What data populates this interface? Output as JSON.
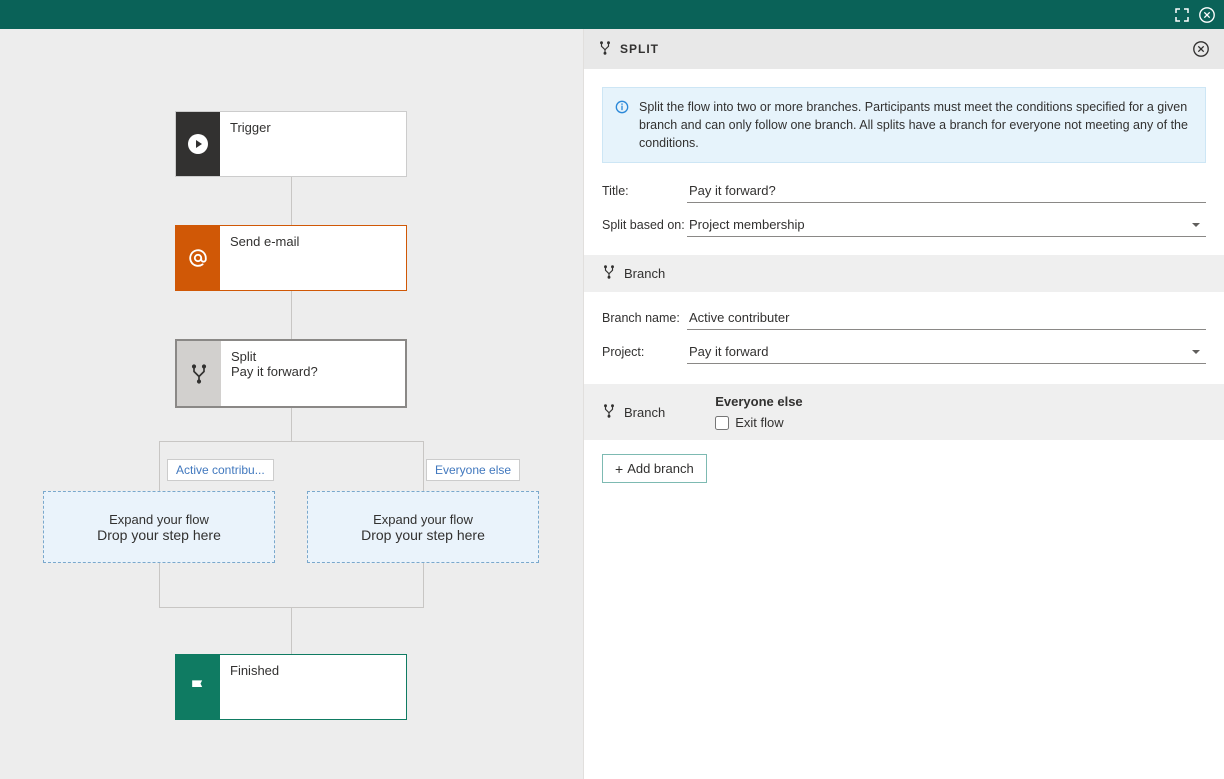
{
  "panel": {
    "title": "SPLIT",
    "info_text": "Split the flow into two or more branches. Participants must meet the conditions specified for a given branch and can only follow one branch. All splits have a branch for everyone not meeting any of the conditions.",
    "title_label": "Title:",
    "title_value": "Pay it forward?",
    "split_based_label": "Split based on:",
    "split_based_value": "Project membership",
    "branch_heading": "Branch",
    "branch_name_label": "Branch name:",
    "branch_name_value": "Active contributer",
    "project_label": "Project:",
    "project_value": "Pay it forward",
    "everyone_branch_label": "Branch",
    "everyone_else_label": "Everyone else",
    "exit_flow_label": "Exit flow",
    "add_branch_label": "Add branch"
  },
  "canvas": {
    "trigger": {
      "title": "Trigger"
    },
    "email": {
      "title": "Send e-mail"
    },
    "split": {
      "title": "Split",
      "sub": "Pay it forward?"
    },
    "finish": {
      "title": "Finished"
    },
    "tag_left": "Active contribu...",
    "tag_right": "Everyone else",
    "drop_heading": "Expand your flow",
    "drop_sub": "Drop your step here"
  }
}
